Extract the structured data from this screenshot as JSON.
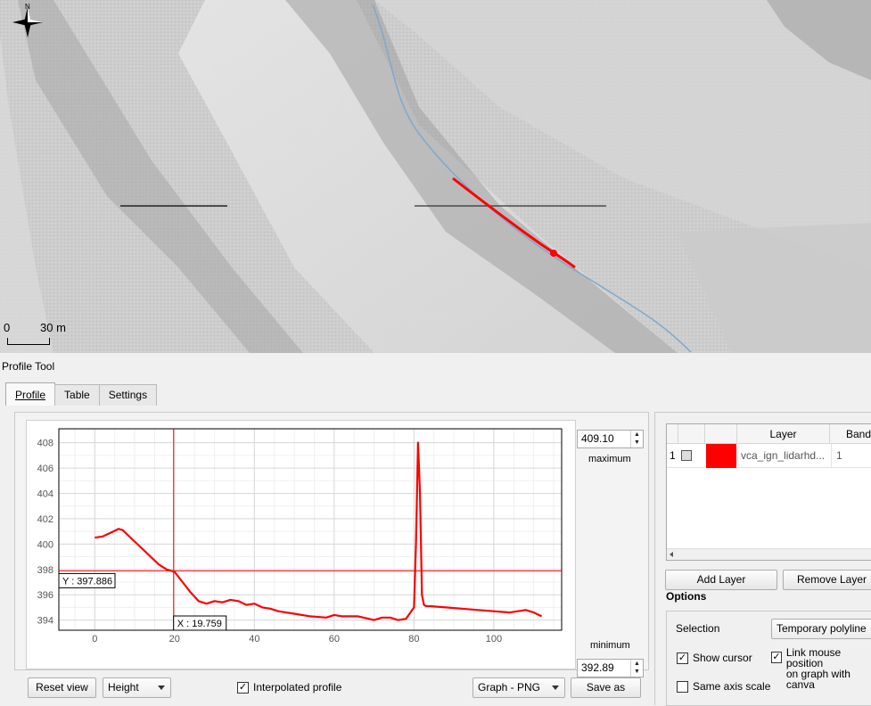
{
  "map": {
    "north_label": "N",
    "scale": {
      "start": "0",
      "end": "30 m"
    }
  },
  "panel": {
    "title": "Profile Tool"
  },
  "tabs": [
    {
      "label": "Profile",
      "active": true
    },
    {
      "label": "Table",
      "active": false
    },
    {
      "label": "Settings",
      "active": false
    }
  ],
  "plot": {
    "y_ticks": [
      "408",
      "406",
      "404",
      "402",
      "400",
      "398",
      "396",
      "394"
    ],
    "x_ticks": [
      "0",
      "20",
      "40",
      "60",
      "80",
      "100"
    ],
    "cursor_y_label": "Y : 397.886",
    "cursor_x_label": "X : 19.759",
    "line_color": "#ff0000"
  },
  "chart_data": {
    "type": "line",
    "xlim": [
      -9,
      117
    ],
    "ylim": [
      393.2,
      409.1
    ],
    "cursor": {
      "x": 19.759,
      "y": 397.886
    },
    "series": [
      {
        "x": [
          0,
          2,
          4,
          6,
          7,
          8,
          10,
          12,
          14,
          16,
          18,
          20,
          22,
          24,
          26,
          28,
          30,
          32,
          34,
          36,
          38,
          40,
          42,
          44,
          46,
          50,
          54,
          58,
          60,
          62,
          66,
          70,
          72,
          74,
          76,
          78,
          80,
          80.5,
          81,
          81.5,
          82,
          82.5,
          83,
          84,
          88,
          92,
          96,
          100,
          104,
          108,
          110,
          112
        ],
        "y": [
          400.5,
          400.6,
          400.9,
          401.2,
          401.1,
          400.8,
          400.2,
          399.6,
          399.0,
          398.4,
          398.0,
          397.8,
          397.0,
          396.2,
          395.5,
          395.3,
          395.5,
          395.4,
          395.6,
          395.5,
          395.2,
          395.3,
          395.0,
          394.9,
          394.7,
          394.5,
          394.3,
          394.2,
          394.4,
          394.3,
          394.3,
          394.0,
          394.2,
          394.2,
          394.0,
          394.1,
          395.0,
          400.0,
          408.0,
          404.0,
          396.0,
          395.2,
          395.1,
          395.1,
          395.0,
          394.9,
          394.8,
          394.7,
          394.6,
          394.8,
          394.6,
          394.3
        ]
      }
    ]
  },
  "limits": {
    "max_value": "409.10",
    "max_label": "maximum",
    "min_value": "392.89",
    "min_label": "minimum"
  },
  "bottom": {
    "reset_view": "Reset view",
    "mode_value": "Height",
    "interpolated_label": "Interpolated profile",
    "interpolated_checked": true,
    "export_value": "Graph - PNG",
    "save_as": "Save as"
  },
  "layer_table": {
    "headers": [
      "Layer",
      "Band"
    ],
    "rows": [
      {
        "index": "1",
        "color": "#ff0000",
        "layer": "vca_ign_lidarhd...",
        "band": "1"
      }
    ]
  },
  "layer_buttons": {
    "add": "Add Layer",
    "remove": "Remove Layer"
  },
  "options": {
    "title": "Options",
    "selection_label": "Selection",
    "selection_value": "Temporary polyline",
    "show_cursor": "Show cursor",
    "link_mouse_line1": "Link mouse position",
    "link_mouse_line2": "on graph with canva",
    "same_axis": "Same axis scale"
  }
}
